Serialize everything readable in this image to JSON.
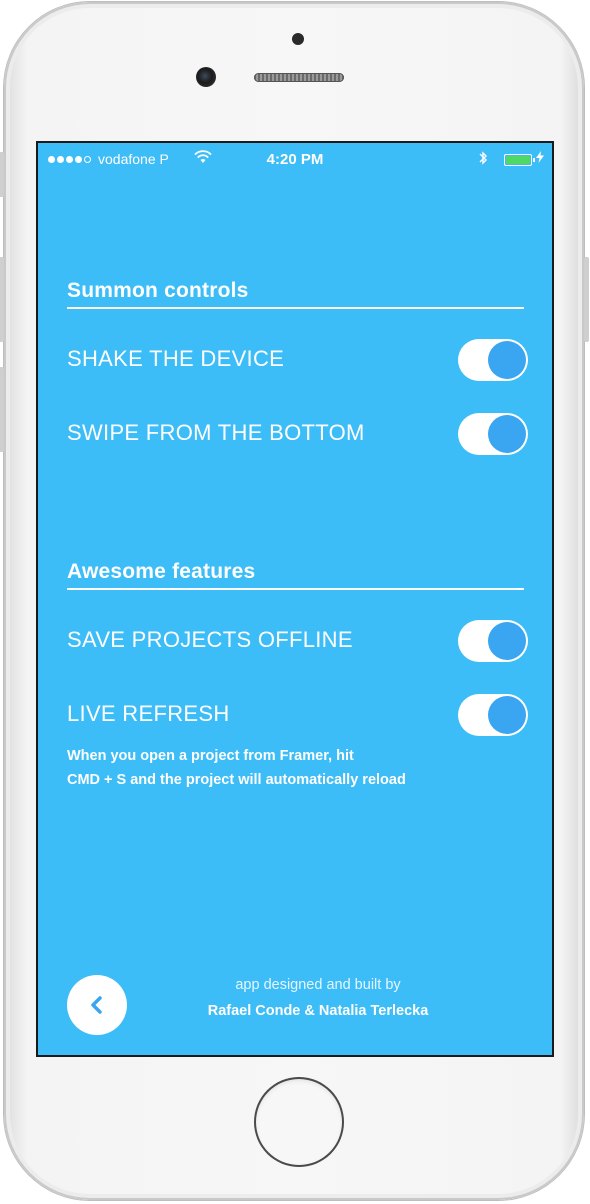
{
  "status_bar": {
    "carrier": "vodafone P",
    "time": "4:20 PM",
    "signal_bars_filled": 4,
    "signal_bars_total": 5,
    "battery_level": 1.0,
    "battery_color": "#4cd964"
  },
  "colors": {
    "background": "#3dbdf8",
    "toggle_knob": "#3aa5f0",
    "text": "#ffffff"
  },
  "sections": [
    {
      "title": "Summon controls",
      "items": [
        {
          "label": "SHAKE THE DEVICE",
          "enabled": true
        },
        {
          "label": "SWIPE FROM THE BOTTOM",
          "enabled": true
        }
      ]
    },
    {
      "title": "Awesome features",
      "items": [
        {
          "label": "SAVE PROJECTS OFFLINE",
          "enabled": true
        },
        {
          "label": "LIVE REFRESH",
          "enabled": true
        }
      ]
    }
  ],
  "live_refresh_note": {
    "line1": "When you open a project from Framer, hit",
    "line2": "CMD + S and the project will automatically reload"
  },
  "footer": {
    "back_icon": "chevron-left-icon",
    "credit_line1": "app designed and built by",
    "credit_line2": "Rafael Conde & Natalia Terlecka"
  }
}
